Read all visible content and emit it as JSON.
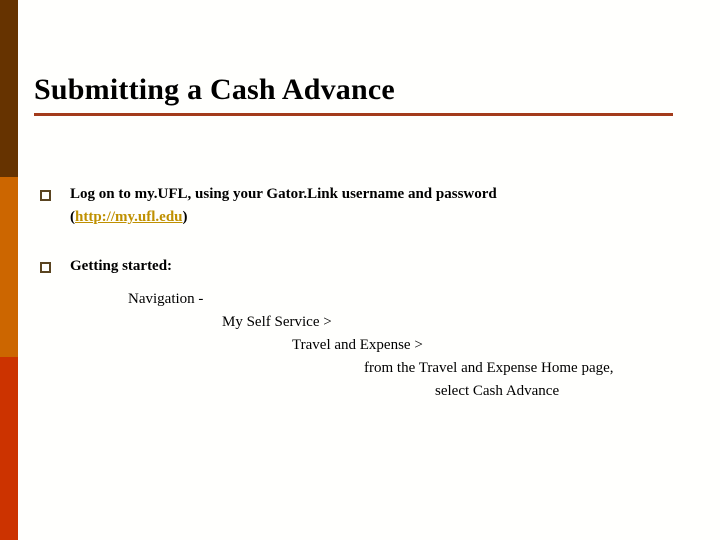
{
  "slide": {
    "title": "Submitting a Cash Advance",
    "background_color": "#fffffd",
    "accent_rule_color": "#a33b1b"
  },
  "decor": {
    "band_top_color": "#663300",
    "band_middle_color": "#cc6600",
    "band_bottom_color": "#cc3300"
  },
  "bullets": [
    {
      "marker": "hollow-square",
      "text": "Log on to my.UFL, using your Gator.Link username and password",
      "sub_line_prefix": "(",
      "link_text": "http://my.ufl.edu",
      "link_color": "#bf9000",
      "sub_line_suffix": ")"
    },
    {
      "marker": "hollow-square",
      "text": "Getting started:"
    }
  ],
  "navigation": {
    "lines": [
      "Navigation -",
      "My Self Service >",
      "Travel and Expense >",
      "from the Travel and Expense Home page,",
      "select Cash Advance"
    ]
  }
}
